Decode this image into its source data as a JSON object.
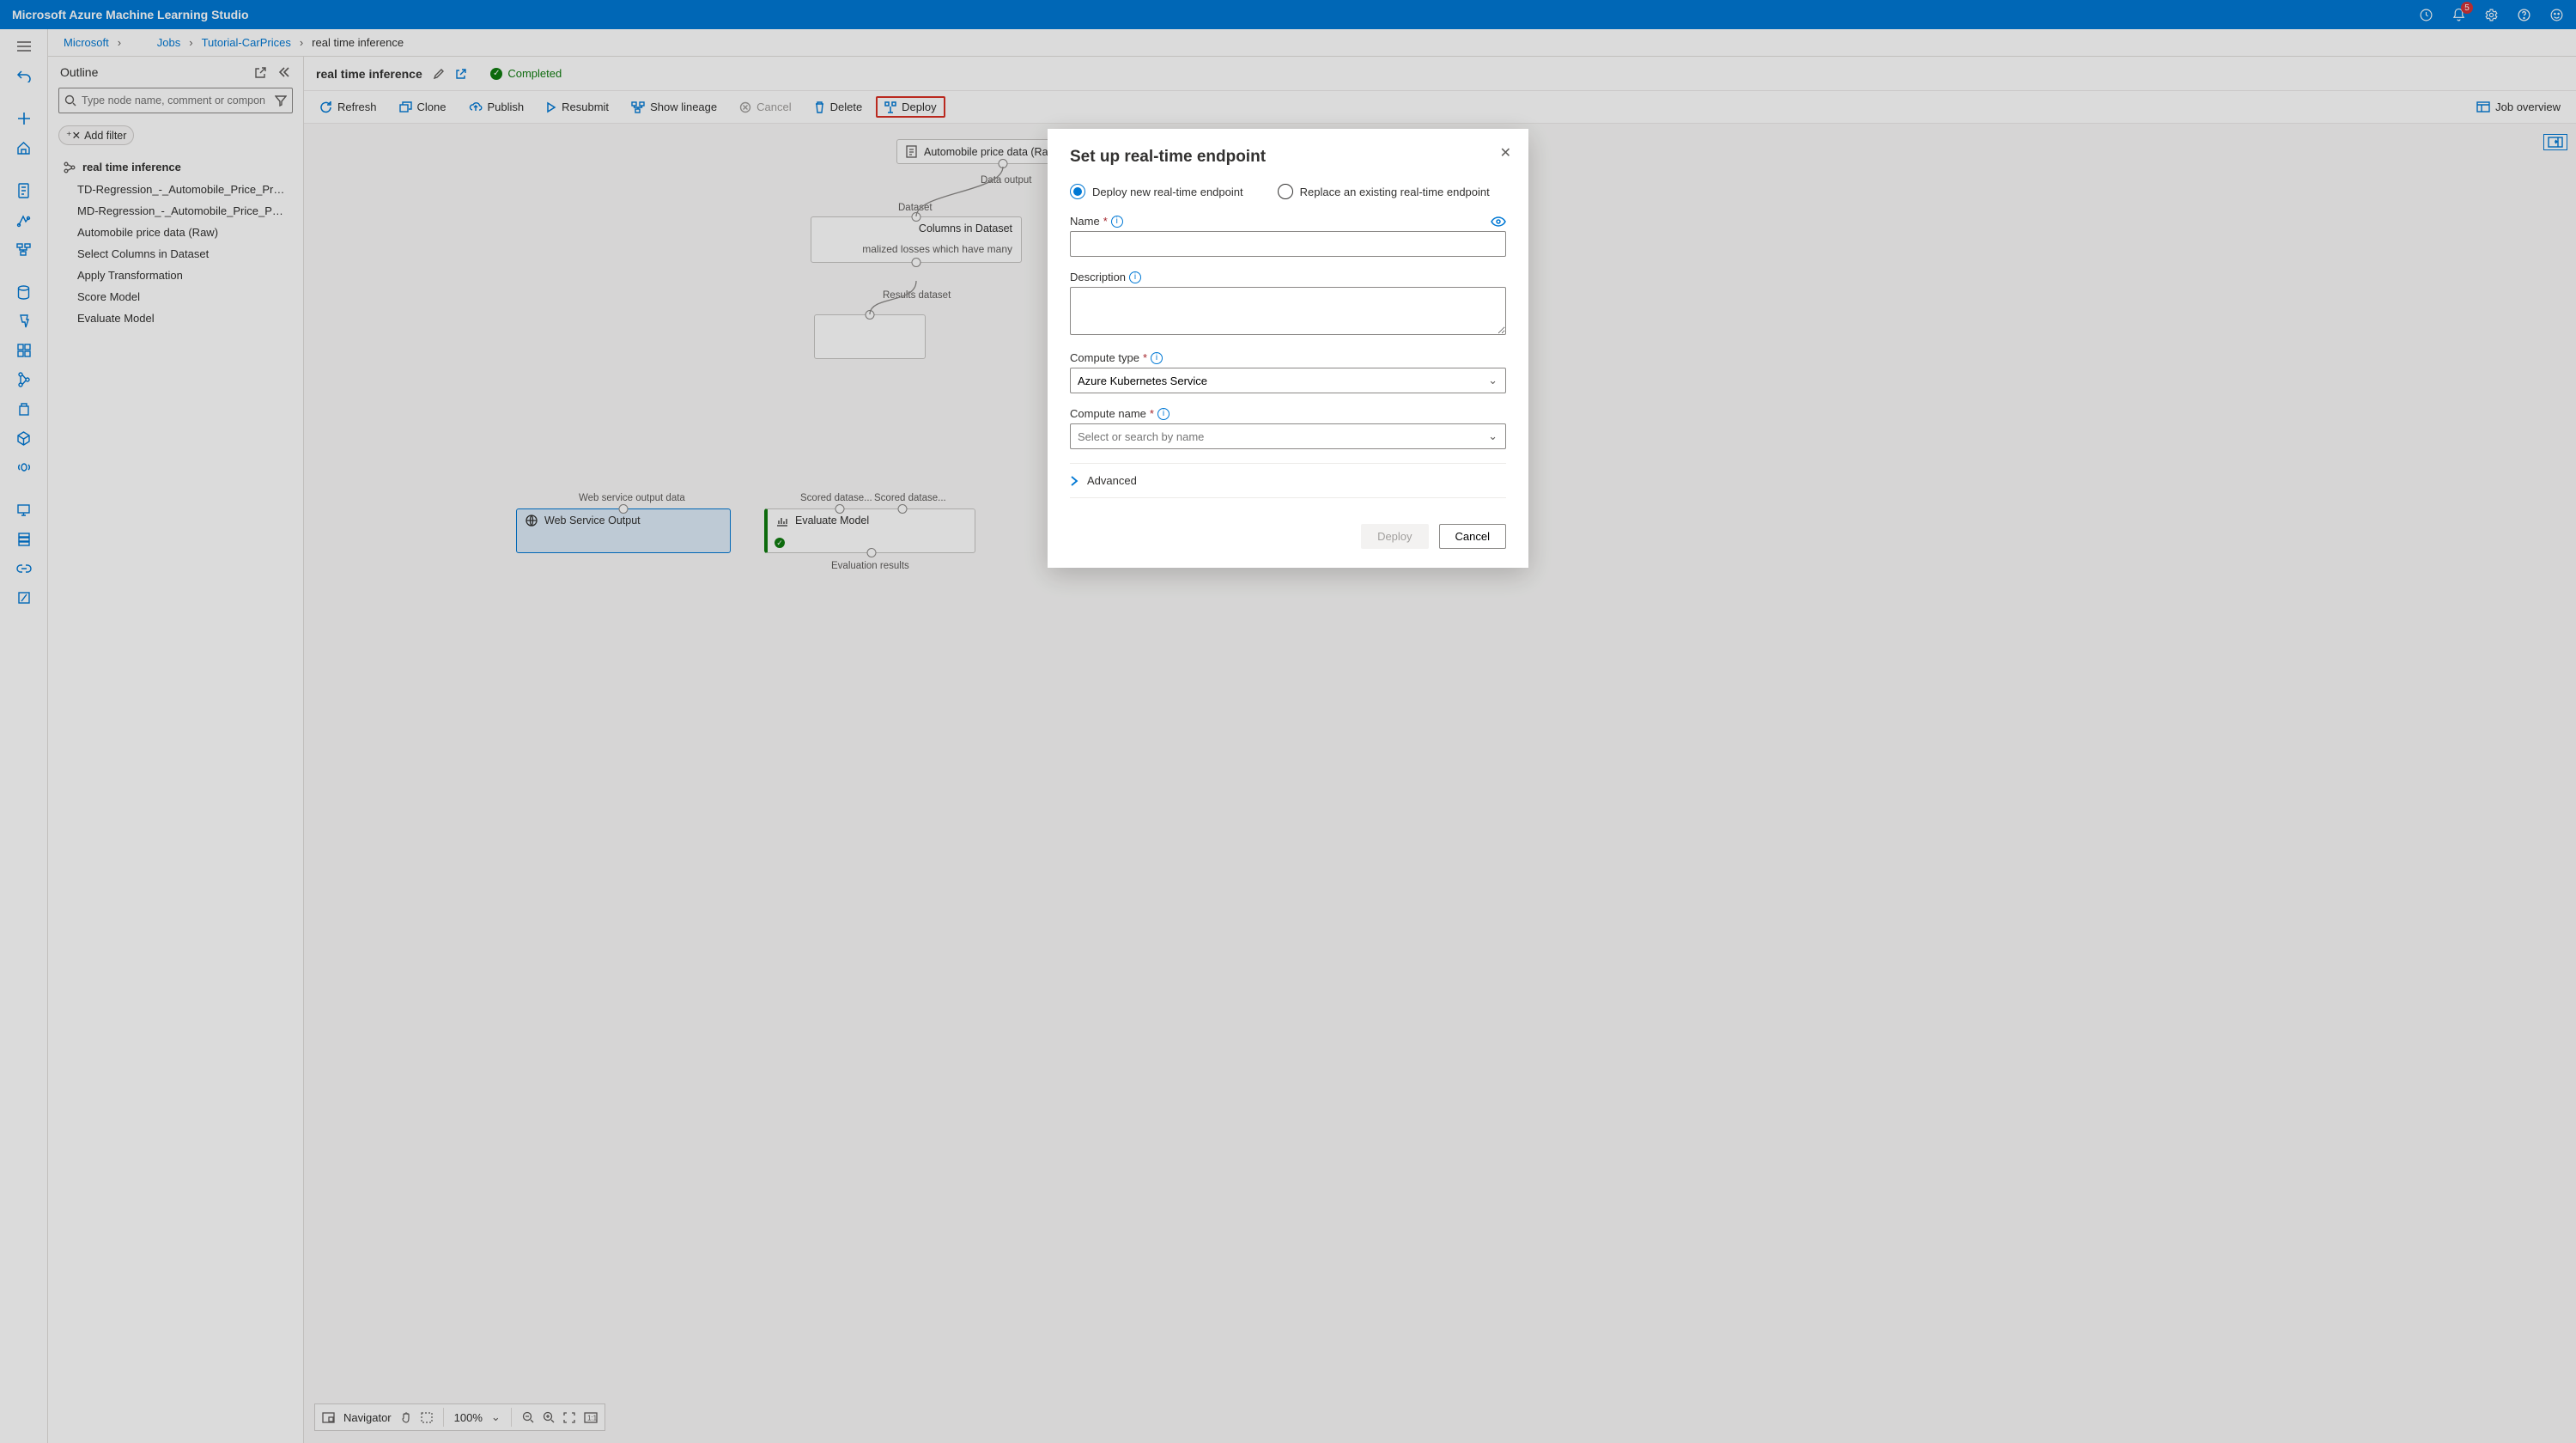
{
  "topbar": {
    "title": "Microsoft Azure Machine Learning Studio",
    "notif_count": "5"
  },
  "breadcrumb": {
    "root": "Microsoft",
    "jobs": "Jobs",
    "experiment": "Tutorial-CarPrices",
    "current": "real time inference"
  },
  "outline": {
    "title": "Outline",
    "search_placeholder": "Type node name, comment or compon",
    "add_filter": "Add filter",
    "root": "real time inference",
    "items": [
      "TD-Regression_-_Automobile_Price_Predict...",
      "MD-Regression_-_Automobile_Price_Predic...",
      "Automobile price data (Raw)",
      "Select Columns in Dataset",
      "Apply Transformation",
      "Score Model",
      "Evaluate Model"
    ]
  },
  "canvas_header": {
    "title": "real time inference",
    "status": "Completed"
  },
  "toolbar": {
    "refresh": "Refresh",
    "clone": "Clone",
    "publish": "Publish",
    "resubmit": "Resubmit",
    "lineage": "Show lineage",
    "cancel": "Cancel",
    "delete": "Delete",
    "deploy": "Deploy",
    "job_overview": "Job overview"
  },
  "canvas": {
    "node_auto_raw": "Automobile price data (Raw)",
    "lbl_data_output": "Data output",
    "lbl_dataset": "Dataset",
    "node_select_cols": "Columns in Dataset",
    "node_select_cols_desc": "malized losses which have many",
    "lbl_results_dataset": "Results dataset",
    "lbl_ws_out_data": "Web service output data",
    "lbl_scored": "Scored datase...",
    "lbl_scored2": "Scored datase...",
    "node_ws_output": "Web Service Output",
    "node_eval": "Evaluate Model",
    "lbl_eval_results": "Evaluation results"
  },
  "navigator": {
    "label": "Navigator",
    "zoom": "100%"
  },
  "modal": {
    "title": "Set up real-time endpoint",
    "opt_new": "Deploy new real-time endpoint",
    "opt_replace": "Replace an existing real-time endpoint",
    "name_label": "Name",
    "desc_label": "Description",
    "compute_type_label": "Compute type",
    "compute_type_value": "Azure Kubernetes Service",
    "compute_name_label": "Compute name",
    "compute_name_placeholder": "Select or search by name",
    "advanced": "Advanced",
    "deploy_btn": "Deploy",
    "cancel_btn": "Cancel"
  }
}
